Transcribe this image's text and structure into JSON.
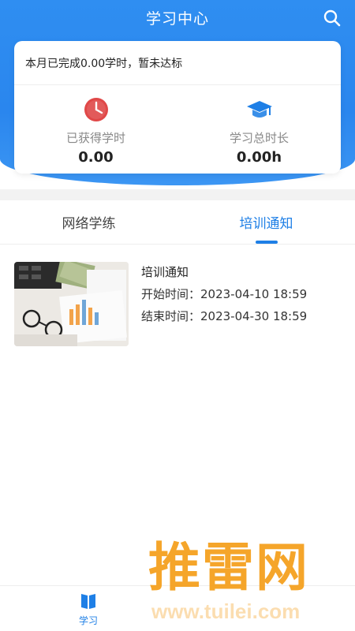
{
  "header": {
    "title": "学习中心",
    "search_icon": "search-icon"
  },
  "card": {
    "notice": "本月已完成0.00学时，暂未达标",
    "stats": [
      {
        "label": "已获得学时",
        "value": "0.00",
        "icon": "clock-icon"
      },
      {
        "label": "学习总时长",
        "value": "0.00h",
        "icon": "graduation-cap-icon"
      }
    ]
  },
  "tabs": [
    {
      "label": "网络学练",
      "active": false
    },
    {
      "label": "培训通知",
      "active": true
    }
  ],
  "list": [
    {
      "title": "培训通知",
      "start": "开始时间：2023-04-10 18:59",
      "end": "结束时间：2023-04-30 18:59"
    }
  ],
  "bottom_nav": {
    "items": [
      {
        "label": "学习",
        "icon": "book-icon",
        "active": true
      }
    ]
  },
  "watermark": {
    "text": "推雷网",
    "url": "www.tuilei.com"
  },
  "colors": {
    "primary": "#1e7fe6",
    "header": "#2f8ef1",
    "clock_red": "#e04848",
    "watermark": "#f5a11f"
  }
}
